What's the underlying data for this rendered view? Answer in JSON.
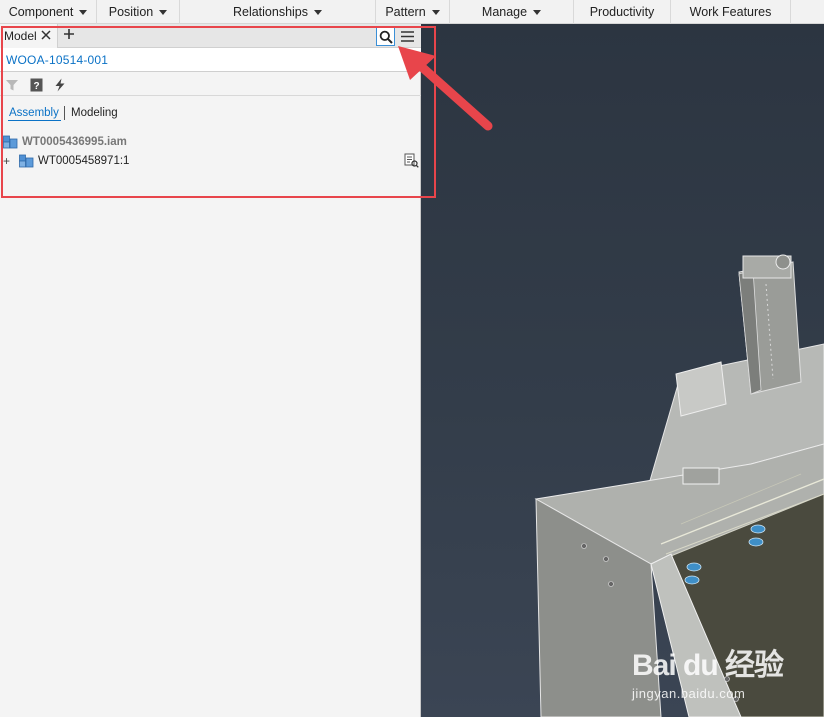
{
  "ribbon": {
    "panels": [
      {
        "label": "Component",
        "has_dropdown": true
      },
      {
        "label": "Position",
        "has_dropdown": true
      },
      {
        "label": "Relationships",
        "has_dropdown": true
      },
      {
        "label": "Pattern",
        "has_dropdown": true
      },
      {
        "label": "Manage",
        "has_dropdown": true
      },
      {
        "label": "Productivity",
        "has_dropdown": false
      },
      {
        "label": "Work Features",
        "has_dropdown": false
      }
    ]
  },
  "browser": {
    "tab_label": "Model",
    "close_icon": "close-icon",
    "add_icon": "plus-icon",
    "search_icon": "search-icon",
    "menu_icon": "hamburger-menu-icon",
    "search_value": "WOOA-10514-001",
    "tools": [
      "filter-icon",
      "help-icon",
      "lightning-icon"
    ],
    "views": {
      "assembly": "Assembly",
      "modeling": "Modeling",
      "active": "assembly"
    },
    "tree": {
      "root": "WT0005436995.iam",
      "children": [
        {
          "label": "WT0005458971:1",
          "expandable": true
        }
      ]
    }
  },
  "annotation": {
    "color": "#e8454b"
  },
  "colors": {
    "accent": "#0b72c6",
    "viewport_bg": "#2f3845",
    "search_border": "#3a8fd6"
  },
  "watermark": {
    "main": "Bai du 经验",
    "sub": "jingyan.baidu.com"
  }
}
